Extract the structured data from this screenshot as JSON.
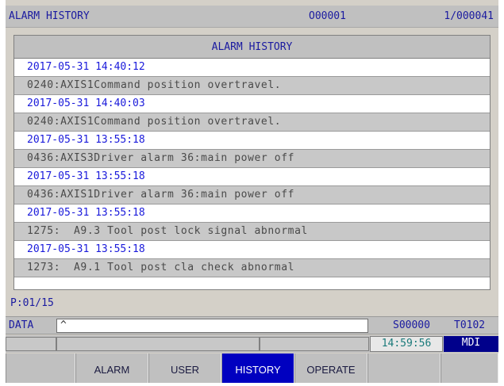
{
  "titlebar": {
    "title": "ALARM HISTORY",
    "program": "O00001",
    "page": "1/000041"
  },
  "panel": {
    "header": "ALARM HISTORY",
    "rows": [
      {
        "type": "date",
        "text": "2017-05-31 14:40:12"
      },
      {
        "type": "msg",
        "text": "0240:AXIS1Command position overtravel."
      },
      {
        "type": "date",
        "text": "2017-05-31 14:40:03"
      },
      {
        "type": "msg",
        "text": "0240:AXIS1Command position overtravel."
      },
      {
        "type": "date",
        "text": "2017-05-31 13:55:18"
      },
      {
        "type": "msg",
        "text": "0436:AXIS3Driver alarm 36:main power off"
      },
      {
        "type": "date",
        "text": "2017-05-31 13:55:18"
      },
      {
        "type": "msg",
        "text": "0436:AXIS1Driver alarm 36:main power off"
      },
      {
        "type": "date",
        "text": "2017-05-31 13:55:18"
      },
      {
        "type": "msg",
        "text": "1275:  A9.3 Tool post lock signal abnormal"
      },
      {
        "type": "date",
        "text": "2017-05-31 13:55:18"
      },
      {
        "type": "msg",
        "text": "1273:  A9.1 Tool post cla check abnormal"
      }
    ]
  },
  "pager": "P:01/15",
  "data_input": {
    "label": "DATA",
    "value": "^"
  },
  "status": {
    "s_code": "S00000",
    "t_code": "T0102",
    "clock": "14:59:56",
    "mode": "MDI"
  },
  "softkeys": [
    "",
    "ALARM",
    "USER",
    "HISTORY",
    "OPERATE",
    "",
    ""
  ],
  "active_softkey": "HISTORY",
  "colors": {
    "accent_blue": "#0000c0",
    "mode_bg": "#00008b",
    "date_text": "#1a1adb"
  }
}
